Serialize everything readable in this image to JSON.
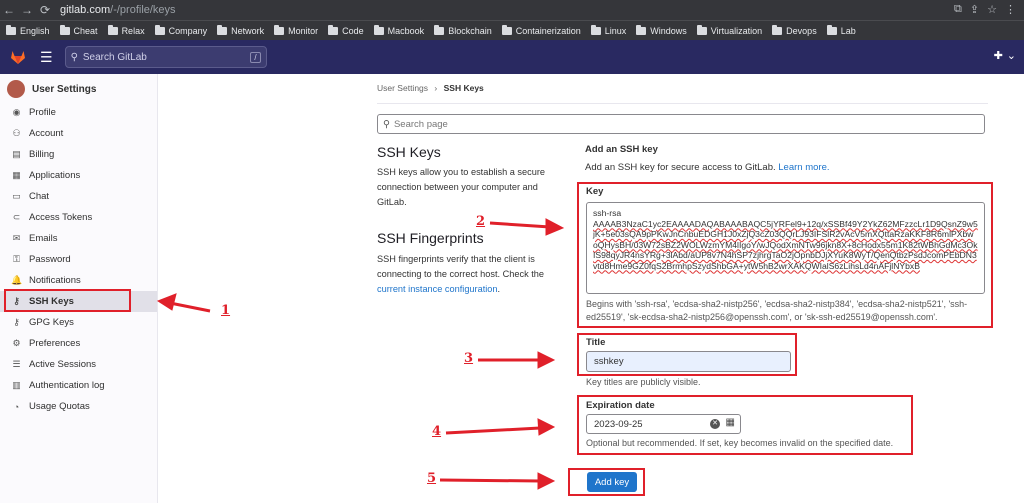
{
  "browser": {
    "back": "←",
    "forward": "→",
    "reload": "⟳",
    "url_host": "gitlab.com",
    "url_path": "/-/profile/keys",
    "bookmarks": [
      "English",
      "Cheat",
      "Relax",
      "Company",
      "Network",
      "Monitor",
      "Code",
      "Macbook",
      "Blockchain",
      "Containerization",
      "Linux",
      "Windows",
      "Virtualization",
      "Devops",
      "Lab"
    ]
  },
  "header": {
    "search_placeholder": "Search GitLab",
    "search_shortcut": "/",
    "right_icon": "✚"
  },
  "sidebar": {
    "title": "User Settings",
    "items": [
      {
        "label": "Profile",
        "icon": "◉"
      },
      {
        "label": "Account",
        "icon": "⚇"
      },
      {
        "label": "Billing",
        "icon": "▤"
      },
      {
        "label": "Applications",
        "icon": "▦"
      },
      {
        "label": "Chat",
        "icon": "▭"
      },
      {
        "label": "Access Tokens",
        "icon": "⊂"
      },
      {
        "label": "Emails",
        "icon": "✉"
      },
      {
        "label": "Password",
        "icon": "⚿"
      },
      {
        "label": "Notifications",
        "icon": "🔔"
      },
      {
        "label": "SSH Keys",
        "icon": "⚷"
      },
      {
        "label": "GPG Keys",
        "icon": "⚷"
      },
      {
        "label": "Preferences",
        "icon": "⚙"
      },
      {
        "label": "Active Sessions",
        "icon": "☰"
      },
      {
        "label": "Authentication log",
        "icon": "▥"
      },
      {
        "label": "Usage Quotas",
        "icon": "◔"
      }
    ]
  },
  "breadcrumb": {
    "parent": "User Settings",
    "separator": "›",
    "current": "SSH Keys"
  },
  "page_search_placeholder": "Search page",
  "ssh_keys": {
    "heading": "SSH Keys",
    "description": "SSH keys allow you to establish a secure connection between your computer and GitLab."
  },
  "fingerprints": {
    "heading": "SSH Fingerprints",
    "description": "SSH fingerprints verify that the client is connecting to the correct host. Check the",
    "link": "current instance configuration",
    "period": "."
  },
  "form": {
    "title": "Add an SSH key",
    "intro": "Add an SSH key for secure access to GitLab.",
    "learn_more": "Learn more.",
    "key_label": "Key",
    "key_prefix": "ssh-rsa",
    "key_value": "AAAAB3NzaC1yc2EAAAADAQABAAABAQC5jYRFel9+12q/xSSBf49Y2YkZ62MFzzcLr1D9QsnZ9w5jK+5e03sQA9pPKwJnCnbuEDGH1J0xZjQ3cZ03QQrLJ93IFSlR2vAcV5mXQttaRzaKKF8R6mlPXbwoQHysBH/03W72sBZ2WOLWzmYM4lIgoY/wJQodXmNTw96jkn8X+8cHodx55m1K82tWBhGdMc3OkIS98qyJR4nsYRg+3lAbd/aUP8v7N4hSP7zjhrgTaO2jOpnbDJjXYuK8WyT/QenQtbzPsdJcomPEbDN3vtd8Hme9GZ0fqS2BrmhpSzydShbGA+ytW5hB2wrXAKQWIalS6zLihsLd4nAFjlNYbxB",
    "key_help": "Begins with 'ssh-rsa', 'ecdsa-sha2-nistp256', 'ecdsa-sha2-nistp384', 'ecdsa-sha2-nistp521', 'ssh-ed25519', 'sk-ecdsa-sha2-nistp256@openssh.com', or 'sk-ssh-ed25519@openssh.com'.",
    "title_label": "Title",
    "title_value": "sshkey",
    "title_help": "Key titles are publicly visible.",
    "exp_label": "Expiration date",
    "exp_value": "2023-09-25",
    "exp_help": "Optional but recommended. If set, key becomes invalid on the specified date.",
    "submit": "Add key"
  },
  "annotations": [
    "1",
    "2",
    "3",
    "4",
    "5"
  ],
  "colors": {
    "accent": "#1f75cb",
    "annotation": "#e0202a",
    "header": "#292961"
  }
}
